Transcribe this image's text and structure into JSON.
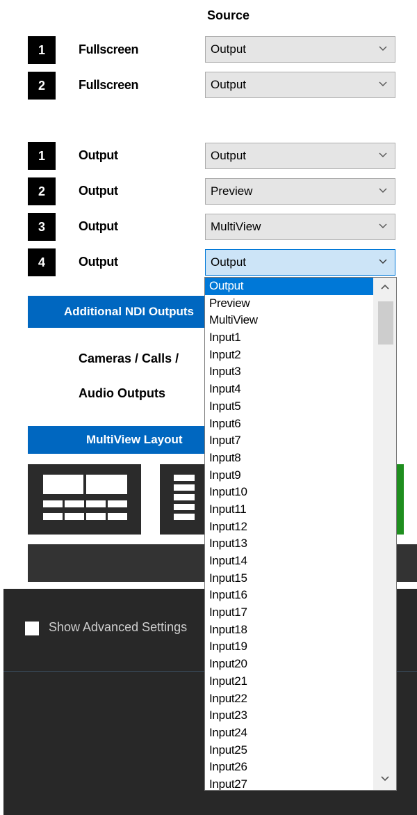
{
  "header": {
    "source": "Source"
  },
  "fullscreen_rows": [
    {
      "number": "1",
      "label": "Fullscreen",
      "value": "Output"
    },
    {
      "number": "2",
      "label": "Fullscreen",
      "value": "Output"
    }
  ],
  "output_rows": [
    {
      "number": "1",
      "label": "Output",
      "value": "Output"
    },
    {
      "number": "2",
      "label": "Output",
      "value": "Preview"
    },
    {
      "number": "3",
      "label": "Output",
      "value": "MultiView"
    },
    {
      "number": "4",
      "label": "Output",
      "value": "Output"
    }
  ],
  "sections": {
    "ndi_header": "Additional NDI Outputs",
    "cameras_label": "Cameras / Calls /",
    "audio_label": "Audio Outputs",
    "multiview_header": "MultiView Layout"
  },
  "footer": {
    "advanced_label": "Show Advanced Settings"
  },
  "dropdown": {
    "selected_index": 0,
    "items": [
      "Output",
      "Preview",
      "MultiView",
      "Input1",
      "Input2",
      "Input3",
      "Input4",
      "Input5",
      "Input6",
      "Input7",
      "Input8",
      "Input9",
      "Input10",
      "Input11",
      "Input12",
      "Input13",
      "Input14",
      "Input15",
      "Input16",
      "Input17",
      "Input18",
      "Input19",
      "Input20",
      "Input21",
      "Input22",
      "Input23",
      "Input24",
      "Input25",
      "Input26",
      "Input27"
    ]
  },
  "icons": {
    "combo_arrow": "chevron-down-icon",
    "scroll_up": "scroll-up-arrow-icon",
    "scroll_down": "scroll-down-arrow-icon"
  },
  "colors": {
    "accent_blue": "#0067c0",
    "selection_blue": "#0078d7",
    "active_combo": "#cce4f7",
    "footer_dark": "#282828",
    "green": "#1e8e1e"
  }
}
